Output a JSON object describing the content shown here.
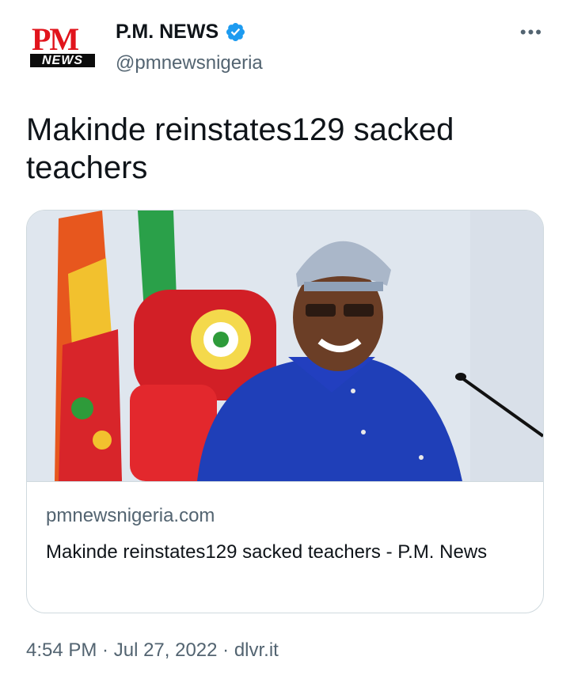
{
  "author": {
    "display_name": "P.M. NEWS",
    "handle": "@pmnewsnigeria",
    "verified": true,
    "avatar_text_top": "PM",
    "avatar_text_bottom": "NEWS"
  },
  "more_icon": "more-dots-icon",
  "tweet": {
    "text": "Makinde reinstates129 sacked teachers"
  },
  "card": {
    "image_subject": "man-in-blue-attire-beside-red-chair-and-flags",
    "domain": "pmnewsnigeria.com",
    "title": "Makinde reinstates129 sacked teachers - P.M. News"
  },
  "meta": {
    "time": "4:54 PM",
    "sep1": " · ",
    "date": "Jul 27, 2022",
    "sep2": " · ",
    "source": "dlvr.it"
  },
  "colors": {
    "brand_red": "#e1141c",
    "verified_blue": "#1d9bf0",
    "text_primary": "#0f1419",
    "text_secondary": "#536471",
    "border": "#cfd9de"
  }
}
